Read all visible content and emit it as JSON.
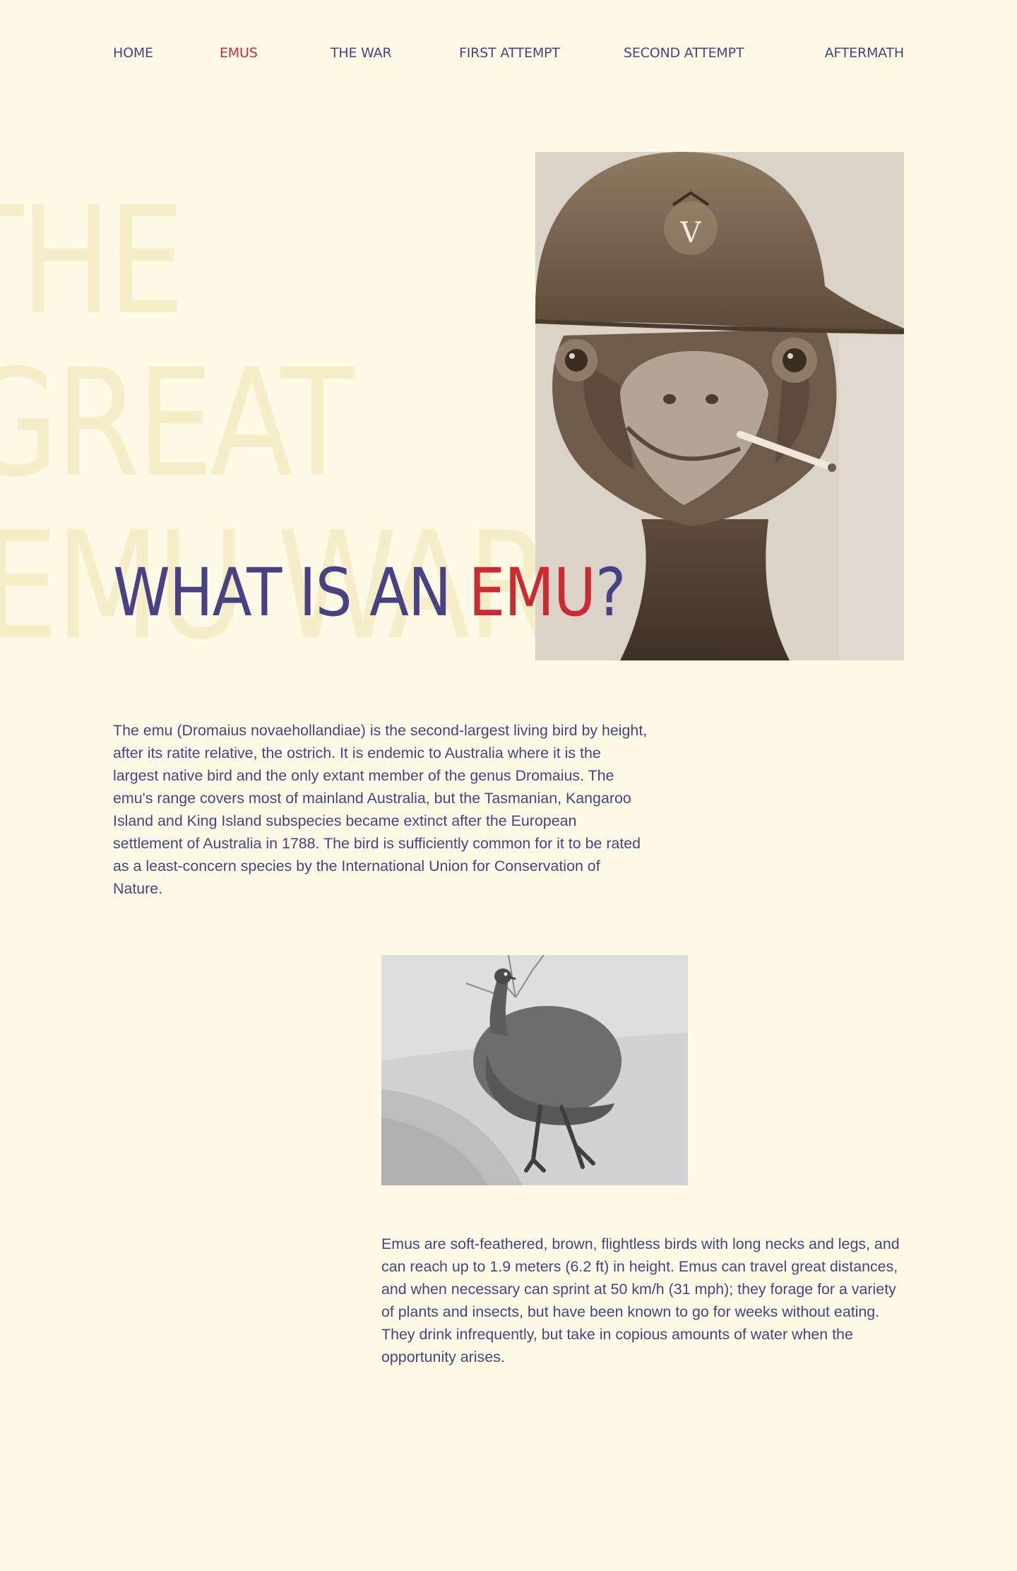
{
  "nav": {
    "items": [
      {
        "label": "HOME",
        "active": false
      },
      {
        "label": "EMUS",
        "active": true
      },
      {
        "label": "THE WAR",
        "active": false
      },
      {
        "label": "FIRST ATTEMPT",
        "active": false
      },
      {
        "label": "SECOND ATTEMPT",
        "active": false
      },
      {
        "label": "AFTERMATH",
        "active": false
      }
    ]
  },
  "background_title": {
    "line1": "THE",
    "line2": "GREAT",
    "line3": "EMU WAR"
  },
  "hero": {
    "photo_helmet_letter": "V"
  },
  "headline": {
    "before": "WHAT IS AN ",
    "accent": "EMU",
    "after": "?"
  },
  "content": {
    "paragraph1": "The emu (Dromaius novaehollandiae) is the second-largest living bird by height, after its ratite relative, the ostrich. It is endemic to Australia where it is the largest native bird and the only extant member of the genus Dromaius. The emu's range covers most of mainland Australia, but the Tasmanian, Kangaroo Island and King Island subspecies became extinct after the European settlement of Australia in 1788. The bird is sufficiently common for it to be rated as a least-concern species by the International Union for Conservation of Nature.",
    "paragraph2": "Emus are soft-feathered, brown, flightless birds with long necks and legs, and can reach up to 1.9 meters (6.2 ft) in height. Emus can travel great distances, and when necessary can sprint at 50 km/h (31 mph); they forage for a variety of plants and insects, but have been known to go for weeks without eating. They drink infrequently, but take in copious amounts of water when the opportunity arises."
  },
  "colors": {
    "background": "#fffae6",
    "primary": "#484284",
    "accent": "#cc2a33",
    "watermark": "#f6eec8"
  }
}
